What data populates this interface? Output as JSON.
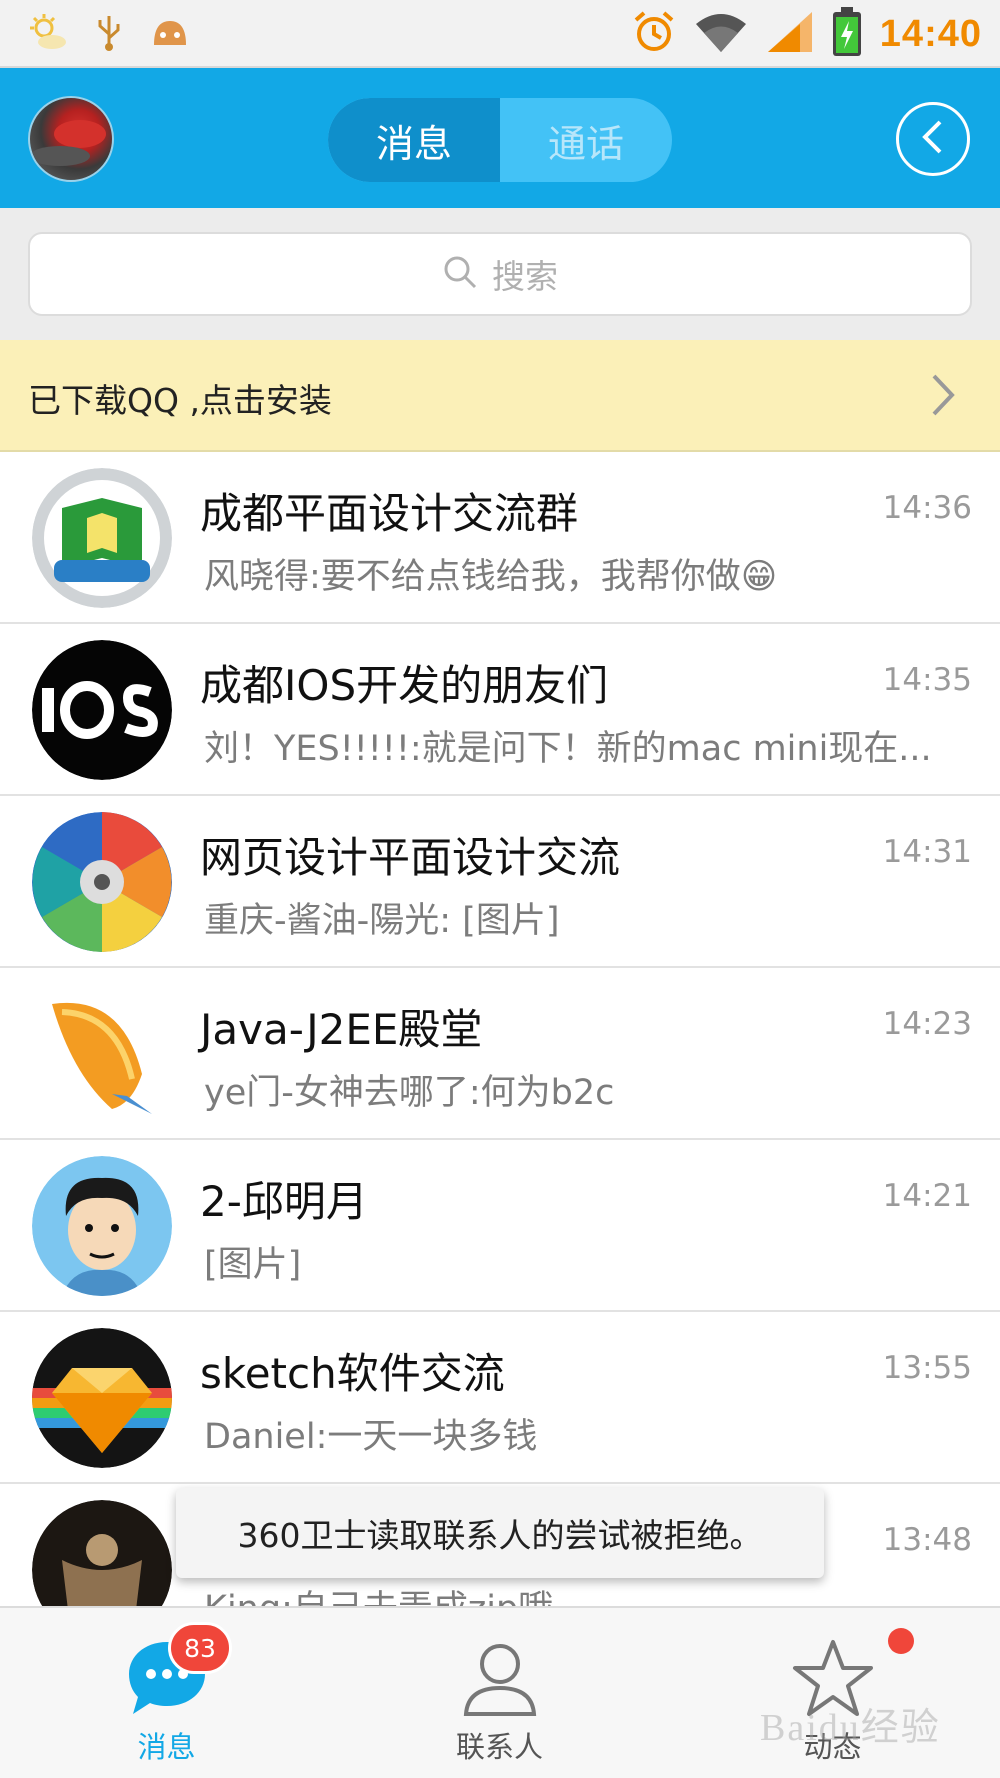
{
  "status_bar": {
    "time": "14:40",
    "icons_left": [
      "weather-icon",
      "usb-icon",
      "android-debug-icon"
    ],
    "icons_right": [
      "alarm-icon",
      "wifi-icon",
      "signal-icon",
      "battery-charging-icon"
    ],
    "accent_color": "#f08a00"
  },
  "header": {
    "tabs": [
      {
        "label": "消息",
        "active": true
      },
      {
        "label": "通话",
        "active": false
      }
    ],
    "background_color": "#12a8e6"
  },
  "search": {
    "placeholder": "搜索"
  },
  "banner": {
    "text": "已下载QQ ,点击安装"
  },
  "conversations": [
    {
      "title": "成都平面设计交流群",
      "time": "14:36",
      "preview": "风晓得:要不给点钱给我，我帮你做😁"
    },
    {
      "title": "成都IOS开发的朋友们",
      "time": "14:35",
      "preview": "刘！YES!!!!!:就是问下！新的mac mini现在..."
    },
    {
      "title": "网页设计平面设计交流",
      "time": "14:31",
      "preview": "重庆-酱油-陽光: [图片]"
    },
    {
      "title": "Java-J2EE殿堂",
      "time": "14:23",
      "preview": "ye门-女神去哪了:何为b2c"
    },
    {
      "title": "2-邱明月",
      "time": "14:21",
      "preview": "[图片]"
    },
    {
      "title": "sketch软件交流",
      "time": "13:55",
      "preview": "Daniel:一天一块多钱"
    },
    {
      "title": "",
      "time": "13:48",
      "preview": "King:自己去弄成zip哦"
    }
  ],
  "toast": {
    "text": "360卫士读取联系人的尝试被拒绝。"
  },
  "bottom_nav": {
    "items": [
      {
        "label": "消息",
        "active": true,
        "badge": "83"
      },
      {
        "label": "联系人",
        "active": false
      },
      {
        "label": "动态",
        "active": false,
        "dot": true
      }
    ],
    "active_color": "#12a8e6",
    "badge_color": "#f0463a"
  },
  "watermark": "Baidu经验"
}
